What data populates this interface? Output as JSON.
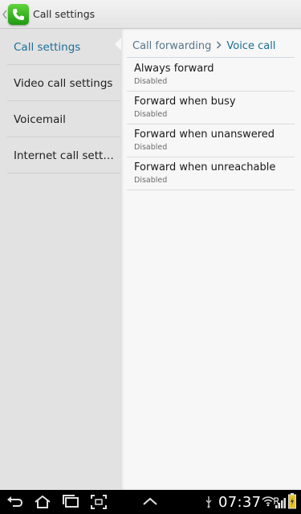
{
  "header": {
    "title": "Call settings",
    "app_icon": "phone-icon",
    "back_icon": "chevron-left-icon"
  },
  "sidebar": {
    "items": [
      {
        "label": "Call settings",
        "selected": true
      },
      {
        "label": "Video call settings",
        "selected": false
      },
      {
        "label": "Voicemail",
        "selected": false
      },
      {
        "label": "Internet call settings",
        "selected": false
      }
    ]
  },
  "breadcrumb": {
    "parent": "Call forwarding",
    "separator_icon": "chevron-right-icon",
    "current": "Voice call"
  },
  "preferences": [
    {
      "title": "Always forward",
      "summary": "Disabled"
    },
    {
      "title": "Forward when busy",
      "summary": "Disabled"
    },
    {
      "title": "Forward when unanswered",
      "summary": "Disabled"
    },
    {
      "title": "Forward when unreachable",
      "summary": "Disabled"
    }
  ],
  "system_bar": {
    "time": "07:37",
    "icons": [
      "back-icon",
      "home-icon",
      "recent-apps-icon",
      "screenshot-icon",
      "up-chevron-icon",
      "usb-icon",
      "wifi-icon",
      "roaming-icon",
      "signal-icon",
      "battery-icon"
    ]
  },
  "colors": {
    "accent": "#1b6e97",
    "action_bar": "#ececec",
    "left_pane": "#e2e2e2",
    "right_pane": "#f7f7f7",
    "system_bar": "#000000",
    "app_icon_green": "#2aa51b"
  }
}
